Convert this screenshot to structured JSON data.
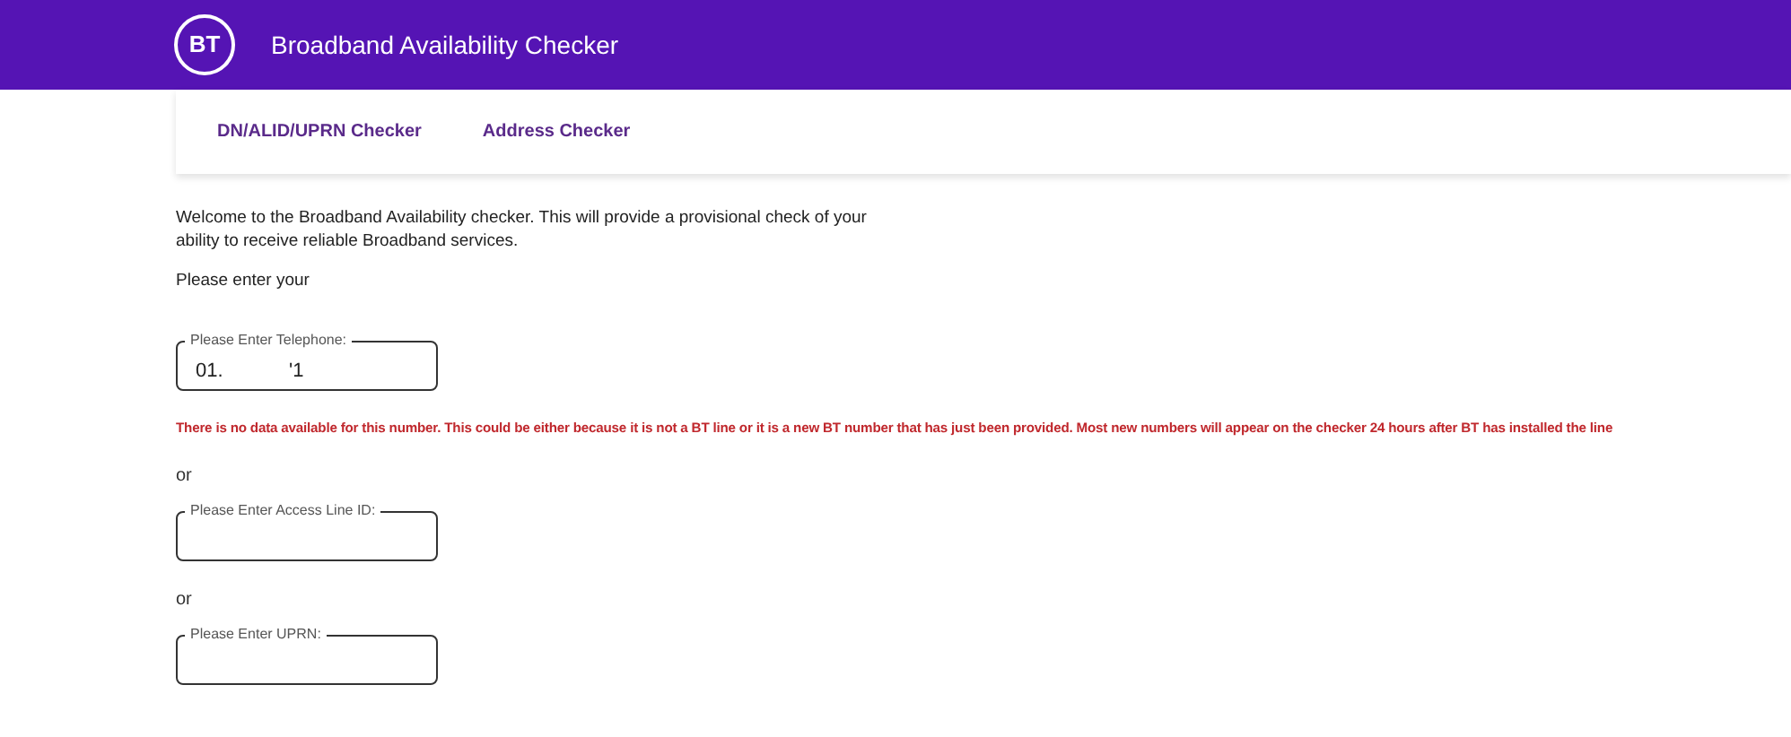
{
  "header": {
    "logo": "BT",
    "title": "Broadband Availability Checker"
  },
  "tabs": [
    {
      "label": "DN/ALID/UPRN Checker"
    },
    {
      "label": "Address Checker"
    }
  ],
  "intro": "Welcome to the Broadband Availability checker. This will provide a provisional check of your ability to receive reliable Broadband services.",
  "prompt": "Please enter your",
  "sections": [
    {
      "kind": "field",
      "label": "Please Enter Telephone:",
      "value": "01.            '1"
    },
    {
      "kind": "error",
      "text": "There is no data available for this number. This could be either because it is not a BT line or it is a new BT number that has just been provided. Most new numbers will appear on the checker 24 hours after BT has installed the line"
    },
    {
      "kind": "separator",
      "text": "or"
    },
    {
      "kind": "field",
      "label": "Please Enter Access Line ID:"
    },
    {
      "kind": "separator",
      "text": "or"
    },
    {
      "kind": "field",
      "label": "Please Enter UPRN:"
    }
  ]
}
